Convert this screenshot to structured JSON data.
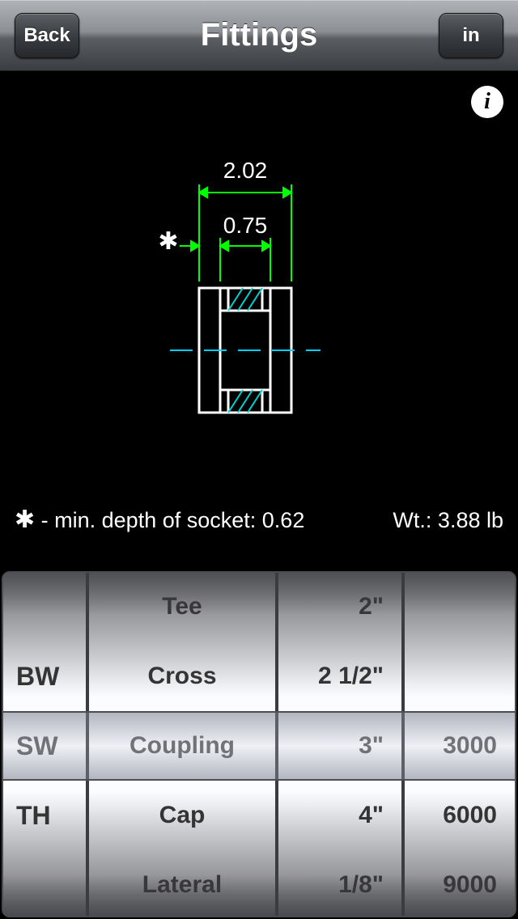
{
  "nav": {
    "back": "Back",
    "title": "Fittings",
    "units": "in"
  },
  "diagram": {
    "dim_outer": "2.02",
    "dim_inner": "0.75",
    "star": "✱",
    "footnote_label": " - min. depth of socket:  ",
    "footnote_value": "0.62",
    "weight_label": "Wt.: ",
    "weight_value": "3.88 lb"
  },
  "picker": {
    "col1": {
      "items": [
        "",
        "BW",
        "SW",
        "TH",
        ""
      ],
      "selected_index": 2
    },
    "col2": {
      "items": [
        "Tee",
        "Cross",
        "Coupling",
        "Cap",
        "Lateral"
      ],
      "selected_index": 2
    },
    "col3": {
      "items": [
        "2\"",
        "2 1/2\"",
        "3\"",
        "4\"",
        "1/8\""
      ],
      "selected_index": 2
    },
    "col4": {
      "items": [
        "",
        "",
        "3000",
        "6000",
        "9000"
      ],
      "selected_index": 2
    }
  }
}
